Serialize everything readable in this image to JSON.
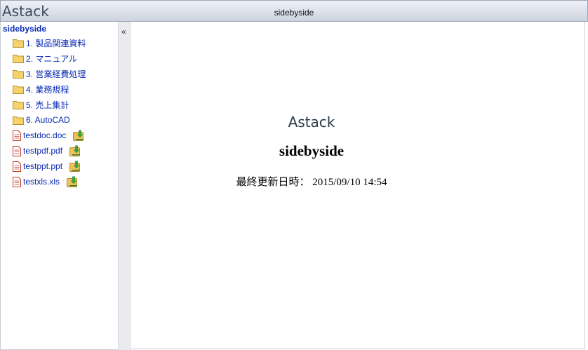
{
  "header": {
    "logo": "Astack",
    "title": "sidebyside"
  },
  "sidebar": {
    "root_label": "sidebyside",
    "collapse_label": "«",
    "folders": [
      {
        "label": "1. 製品関連資料",
        "icon": "folder-icon"
      },
      {
        "label": "2. マニュアル",
        "icon": "folder-icon"
      },
      {
        "label": "3. 営業経費処理",
        "icon": "folder-icon"
      },
      {
        "label": "4. 業務規程",
        "icon": "folder-icon"
      },
      {
        "label": "5. 売上集計",
        "icon": "folder-icon"
      },
      {
        "label": "6. AutoCAD",
        "icon": "folder-icon"
      }
    ],
    "files": [
      {
        "label": "testdoc.doc",
        "icon": "file-icon",
        "action_icon": "download-icon"
      },
      {
        "label": "testpdf.pdf",
        "icon": "file-icon",
        "action_icon": "download-icon"
      },
      {
        "label": "testppt.ppt",
        "icon": "file-icon",
        "action_icon": "download-icon"
      },
      {
        "label": "testxls.xls",
        "icon": "file-icon",
        "action_icon": "download-icon"
      }
    ]
  },
  "main": {
    "logo": "Astack",
    "title": "sidebyside",
    "updated_text": "最終更新日時： 2015/09/10 14:54"
  },
  "colors": {
    "link": "#0a2bb5",
    "folder": "#f5d36a",
    "file_icon": "#c0392b",
    "download": "#3aa23a"
  }
}
